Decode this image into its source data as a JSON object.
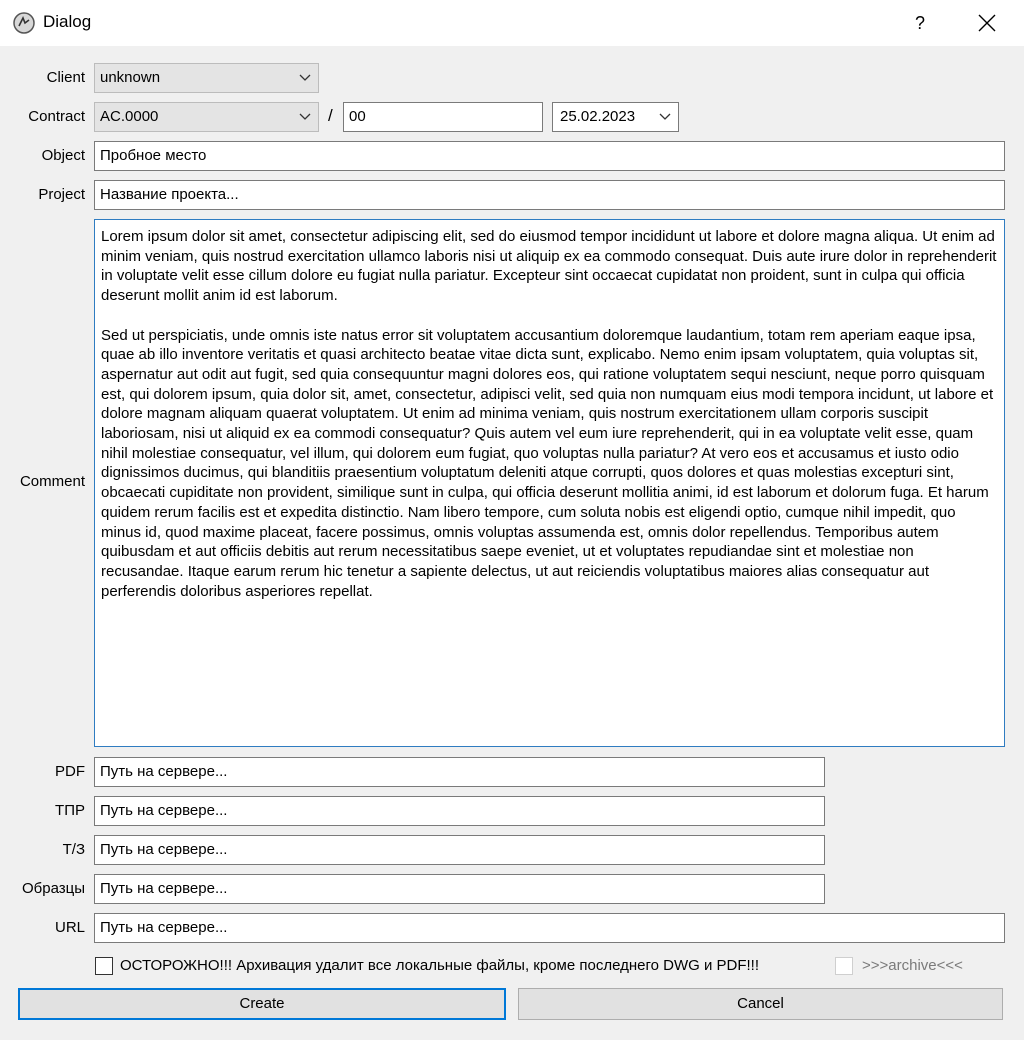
{
  "window": {
    "title": "Dialog",
    "help": "?"
  },
  "client": {
    "label": "Client",
    "value": "unknown"
  },
  "contract": {
    "label": "Contract",
    "code": "AC.0000",
    "separator": "/",
    "number": "00",
    "date": "25.02.2023"
  },
  "object": {
    "label": "Object",
    "value": "Пробное место"
  },
  "project": {
    "label": "Project",
    "placeholder": "Название проекта..."
  },
  "comment": {
    "label": "Comment",
    "text": "Lorem ipsum dolor sit amet, consectetur adipiscing elit, sed do eiusmod tempor incididunt ut labore et dolore magna aliqua. Ut enim ad minim veniam, quis nostrud exercitation ullamco laboris nisi ut aliquip ex ea commodo consequat. Duis aute irure dolor in reprehenderit in voluptate velit esse cillum dolore eu fugiat nulla pariatur. Excepteur sint occaecat cupidatat non proident, sunt in culpa qui officia deserunt mollit anim id est laborum.\n\nSed ut perspiciatis, unde omnis iste natus error sit voluptatem accusantium doloremque laudantium, totam rem aperiam eaque ipsa, quae ab illo inventore veritatis et quasi architecto beatae vitae dicta sunt, explicabo. Nemo enim ipsam voluptatem, quia voluptas sit, aspernatur aut odit aut fugit, sed quia consequuntur magni dolores eos, qui ratione voluptatem sequi nesciunt, neque porro quisquam est, qui dolorem ipsum, quia dolor sit, amet, consectetur, adipisci velit, sed quia non numquam eius modi tempora incidunt, ut labore et dolore magnam aliquam quaerat voluptatem. Ut enim ad minima veniam, quis nostrum exercitationem ullam corporis suscipit laboriosam, nisi ut aliquid ex ea commodi consequatur? Quis autem vel eum iure reprehenderit, qui in ea voluptate velit esse, quam nihil molestiae consequatur, vel illum, qui dolorem eum fugiat, quo voluptas nulla pariatur? At vero eos et accusamus et iusto odio dignissimos ducimus, qui blanditiis praesentium voluptatum deleniti atque corrupti, quos dolores et quas molestias excepturi sint, obcaecati cupiditate non provident, similique sunt in culpa, qui officia deserunt mollitia animi, id est laborum et dolorum fuga. Et harum quidem rerum facilis est et expedita distinctio. Nam libero tempore, cum soluta nobis est eligendi optio, cumque nihil impedit, quo minus id, quod maxime placeat, facere possimus, omnis voluptas assumenda est, omnis dolor repellendus. Temporibus autem quibusdam et aut officiis debitis aut rerum necessitatibus saepe eveniet, ut et voluptates repudiandae sint et molestiae non recusandae. Itaque earum rerum hic tenetur a sapiente delectus, ut aut reiciendis voluptatibus maiores alias consequatur aut perferendis doloribus asperiores repellat."
  },
  "paths": [
    {
      "label": "PDF",
      "placeholder": "Путь на сервере..."
    },
    {
      "label": "ТПР",
      "placeholder": "Путь на сервере..."
    },
    {
      "label": "Т/З",
      "placeholder": "Путь на сервере..."
    },
    {
      "label": "Образцы",
      "placeholder": "Путь на сервере..."
    },
    {
      "label": "URL",
      "placeholder": "Путь на сервере..."
    }
  ],
  "warning": {
    "text": "ОСТОРОЖНО!!! Архивация удалит все локальные файлы, кроме последнего DWG и PDF!!!",
    "checked": false
  },
  "archive": {
    "text": ">>>archive<<<",
    "checked": false
  },
  "buttons": {
    "create": "Create",
    "cancel": "Cancel"
  }
}
